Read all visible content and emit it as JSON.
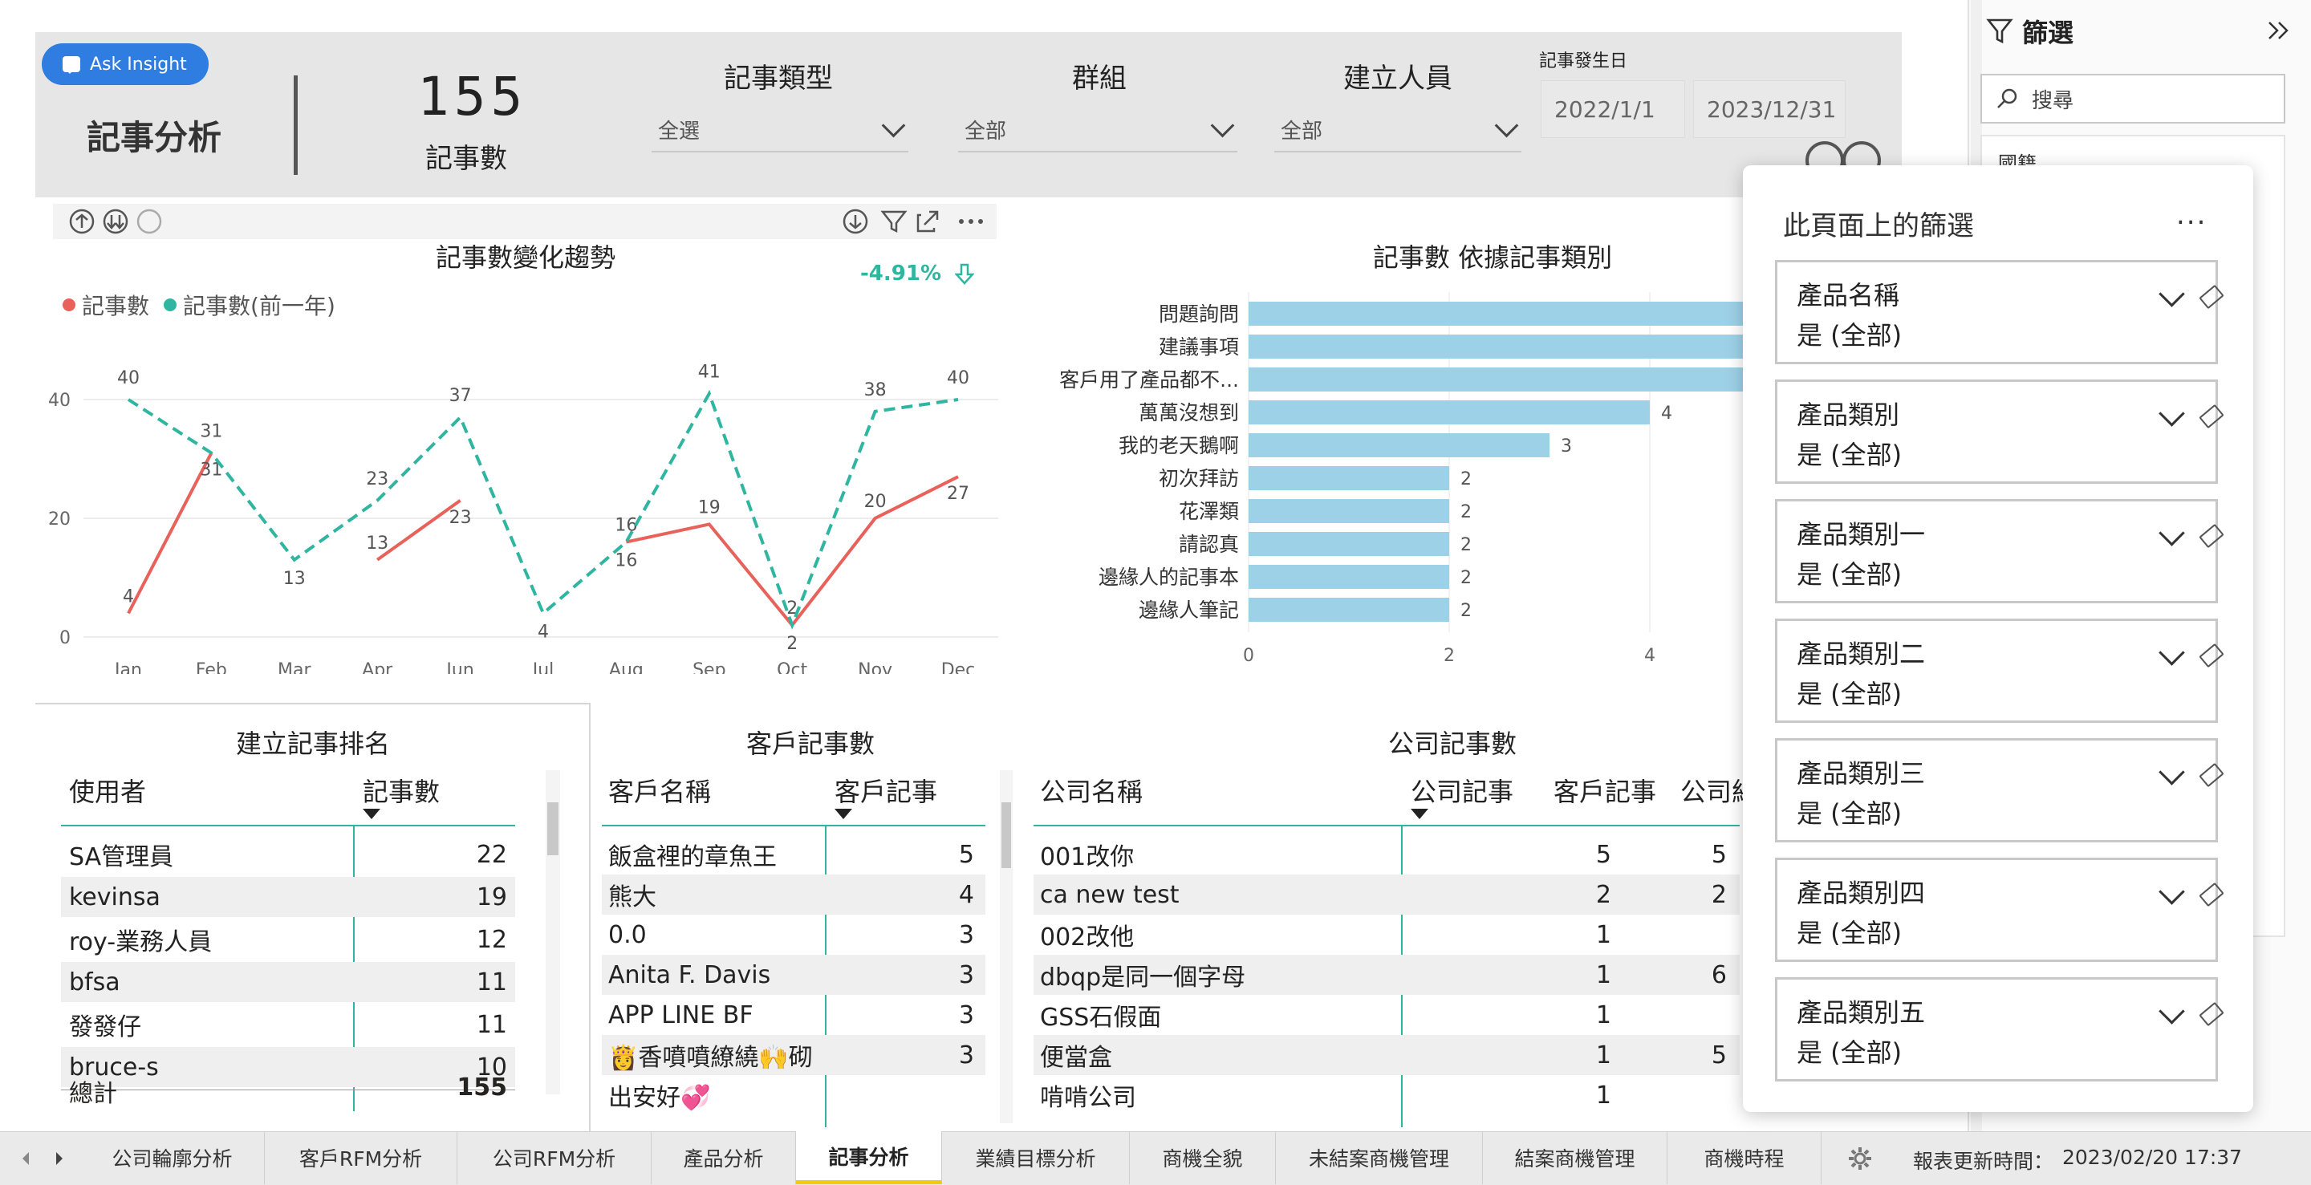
{
  "header": {
    "ask_insight_label": "Ask Insight",
    "page_title": "記事分析",
    "kpi_value": "155",
    "kpi_label": "記事數",
    "slicers": [
      {
        "title": "記事類型",
        "value": "全選"
      },
      {
        "title": "群組",
        "value": "全部"
      },
      {
        "title": "建立人員",
        "value": "全部"
      }
    ],
    "date_slicer": {
      "label": "記事發生日",
      "start": "2022/1/1",
      "end": "2023/12/31"
    }
  },
  "trend_chart": {
    "title": "記事數變化趨勢",
    "change_label": "-4.91%",
    "legend": [
      {
        "name": "記事數",
        "color": "#e8625b"
      },
      {
        "name": "記事數(前一年)",
        "color": "#2fb5a0"
      }
    ],
    "y_ticks": [
      "0",
      "20",
      "40"
    ]
  },
  "chart_data": [
    {
      "type": "line",
      "title": "記事數變化趨勢",
      "x": [
        "Jan",
        "Feb",
        "Mar",
        "Apr",
        "Jun",
        "Jul",
        "Aug",
        "Sep",
        "Oct",
        "Nov",
        "Dec"
      ],
      "ylim": [
        0,
        40
      ],
      "series": [
        {
          "name": "記事數",
          "color": "#e8625b",
          "style": "solid",
          "values": [
            4,
            31,
            null,
            13,
            23,
            null,
            16,
            19,
            2,
            20,
            27
          ]
        },
        {
          "name": "記事數(前一年)",
          "color": "#2fb5a0",
          "style": "dashed",
          "values": [
            40,
            31,
            13,
            23,
            37,
            4,
            16,
            41,
            2,
            38,
            40
          ]
        }
      ]
    },
    {
      "type": "bar",
      "orientation": "horizontal",
      "title": "記事數 依據記事類別",
      "categories": [
        "問題詢問",
        "建議事項",
        "客戶用了產品都不...",
        "萬萬沒想到",
        "我的老天鵝啊",
        "初次拜訪",
        "花澤類",
        "請認真",
        "邊緣人的記事本",
        "邊緣人筆記"
      ],
      "values": [
        null,
        null,
        null,
        4,
        3,
        2,
        2,
        2,
        2,
        2
      ],
      "value_labels": [
        "",
        "",
        "",
        "4",
        "3",
        "2",
        "2",
        "2",
        "2",
        "2"
      ],
      "x_ticks": [
        "0",
        "2",
        "4"
      ],
      "color": "#9dd1e8"
    }
  ],
  "user_ranking": {
    "title": "建立記事排名",
    "columns": [
      "使用者",
      "記事數"
    ],
    "rows": [
      {
        "name": "SA管理員",
        "count": "22"
      },
      {
        "name": "kevinsa",
        "count": "19"
      },
      {
        "name": "roy-業務人員",
        "count": "12"
      },
      {
        "name": "bfsa",
        "count": "11"
      },
      {
        "name": "發發仔",
        "count": "11"
      },
      {
        "name": "bruce-s",
        "count": "10"
      }
    ],
    "total_label": "總計",
    "total_value": "155"
  },
  "customer_table": {
    "title": "客戶記事數",
    "columns": [
      "客戶名稱",
      "客戶記事"
    ],
    "rows": [
      {
        "name": "飯盒裡的章魚王",
        "count": "5"
      },
      {
        "name": "熊大",
        "count": "4"
      },
      {
        "name": "0.0",
        "count": "3"
      },
      {
        "name": "Anita F. Davis",
        "count": "3"
      },
      {
        "name": "APP LINE BF",
        "count": "3"
      },
      {
        "name": "👸香噴噴繚繞🙌砌",
        "count": "3"
      },
      {
        "name": "出安好💞",
        "count": ""
      }
    ]
  },
  "company_table": {
    "title": "公司記事數",
    "columns": [
      "公司名稱",
      "公司記事",
      "客戶記事",
      "公司紀"
    ],
    "rows": [
      {
        "name": "001改你",
        "company": "5",
        "customer": "5"
      },
      {
        "name": "ca new test",
        "company": "2",
        "customer": "2"
      },
      {
        "name": "002改他",
        "company": "1",
        "customer": ""
      },
      {
        "name": "dbqp是同一個字母",
        "company": "1",
        "customer": "6"
      },
      {
        "name": "GSS石假面",
        "company": "1",
        "customer": ""
      },
      {
        "name": "便當盒",
        "company": "1",
        "customer": "5"
      },
      {
        "name": "啃啃公司",
        "company": "1",
        "customer": ""
      }
    ]
  },
  "filter_pane": {
    "title": "篩選",
    "search_placeholder": "搜尋",
    "first_item": "國籍"
  },
  "filter_flyout": {
    "title": "此頁面上的篩選",
    "more": "...",
    "cards": [
      {
        "name": "產品名稱",
        "value": "是 (全部)"
      },
      {
        "name": "產品類別",
        "value": "是 (全部)"
      },
      {
        "name": "產品類別一",
        "value": "是 (全部)"
      },
      {
        "name": "產品類別二",
        "value": "是 (全部)"
      },
      {
        "name": "產品類別三",
        "value": "是 (全部)"
      },
      {
        "name": "產品類別四",
        "value": "是 (全部)"
      },
      {
        "name": "產品類別五",
        "value": "是 (全部)"
      }
    ]
  },
  "tabs": {
    "items": [
      "公司輪廓分析",
      "客戶RFM分析",
      "公司RFM分析",
      "產品分析",
      "記事分析",
      "業績目標分析",
      "商機全貌",
      "未結案商機管理",
      "結案商機管理",
      "商機時程"
    ],
    "active": "記事分析",
    "refresh_label": "報表更新時間：",
    "refresh_time": "2023/02/20 17:37"
  }
}
